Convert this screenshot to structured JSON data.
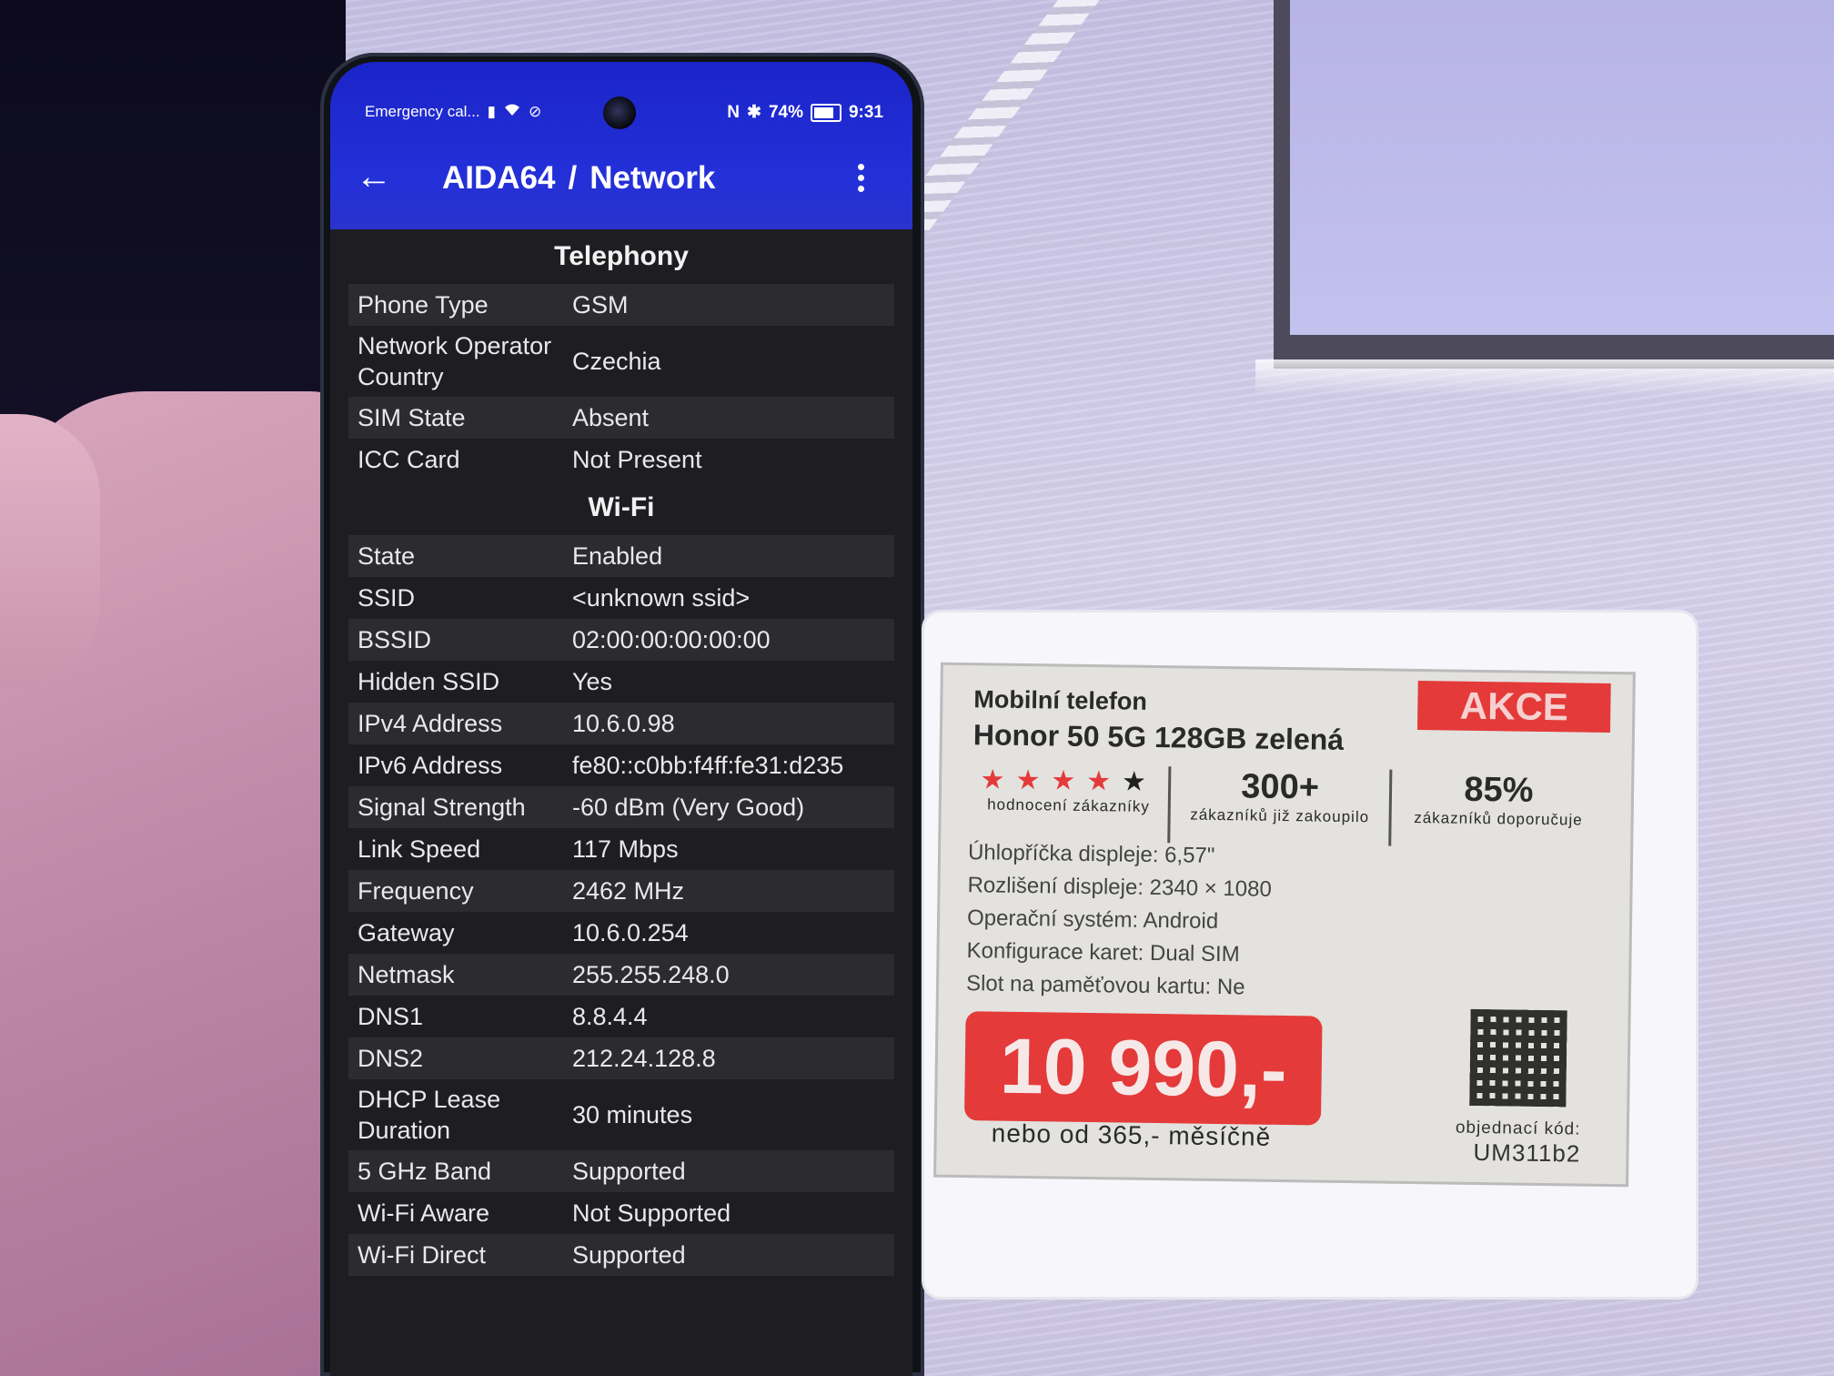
{
  "status_bar": {
    "carrier": "Emergency cal...",
    "battery": "74%",
    "time": "9:31"
  },
  "app_bar": {
    "app_name": "AIDA64",
    "separator": "/",
    "page": "Network"
  },
  "telephony": {
    "title": "Telephony",
    "rows": [
      {
        "label": "Phone Type",
        "value": "GSM"
      },
      {
        "label": "Network Operator Country",
        "value": "Czechia"
      },
      {
        "label": "SIM State",
        "value": "Absent"
      },
      {
        "label": "ICC Card",
        "value": "Not Present"
      }
    ]
  },
  "wifi": {
    "title": "Wi-Fi",
    "rows": [
      {
        "label": "State",
        "value": "Enabled"
      },
      {
        "label": "SSID",
        "value": "<unknown ssid>"
      },
      {
        "label": "BSSID",
        "value": "02:00:00:00:00:00"
      },
      {
        "label": "Hidden SSID",
        "value": "Yes"
      },
      {
        "label": "IPv4 Address",
        "value": "10.6.0.98"
      },
      {
        "label": "IPv6 Address",
        "value": "fe80::c0bb:f4ff:fe31:d235"
      },
      {
        "label": "Signal Strength",
        "value": "-60 dBm (Very Good)"
      },
      {
        "label": "Link Speed",
        "value": "117 Mbps"
      },
      {
        "label": "Frequency",
        "value": "2462 MHz"
      },
      {
        "label": "Gateway",
        "value": "10.6.0.254"
      },
      {
        "label": "Netmask",
        "value": "255.255.248.0"
      },
      {
        "label": "DNS1",
        "value": "8.8.4.4"
      },
      {
        "label": "DNS2",
        "value": "212.24.128.8"
      },
      {
        "label": "DHCP Lease Duration",
        "value": "30 minutes"
      },
      {
        "label": "5 GHz Band",
        "value": "Supported"
      },
      {
        "label": "Wi-Fi Aware",
        "value": "Not Supported"
      },
      {
        "label": "Wi-Fi Direct",
        "value": "Supported"
      }
    ]
  },
  "price_tag": {
    "category": "Mobilní telefon",
    "product": "Honor 50 5G 128GB zelená",
    "badge": "AKCE",
    "rating_stars": "★★★★",
    "rating_star_dim": "★",
    "rating_caption": "hodnocení zákazníky",
    "buyers": "300+",
    "buyers_caption": "zákazníků již zakoupilo",
    "recommend": "85%",
    "recommend_caption": "zákazníků doporučuje",
    "specs": [
      "Úhlopříčka displeje: 6,57\"",
      "Rozlišení displeje: 2340 × 1080",
      "Operační systém: Android",
      "Konfigurace karet: Dual SIM",
      "Slot na paměťovou kartu: Ne"
    ],
    "price": "10 990,-",
    "monthly": "nebo od 365,- měsíčně",
    "order_label": "objednací kód:",
    "order_code": "UM311b2",
    "accent_color": "#e43a3a"
  }
}
